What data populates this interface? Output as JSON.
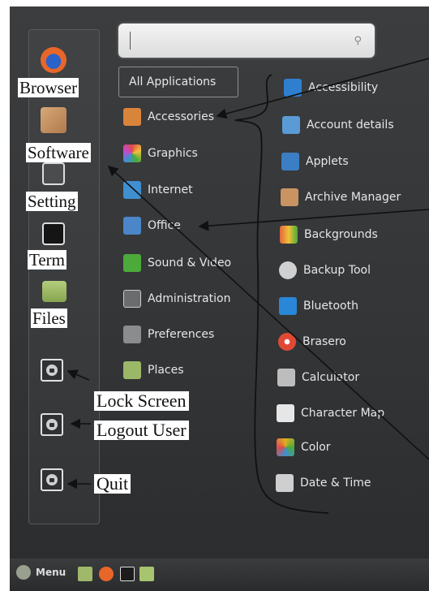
{
  "favorites": [
    {
      "label": "Browser",
      "icon": "firefox-icon",
      "color": "#e8662a"
    },
    {
      "label": "Software",
      "icon": "software-manager-icon",
      "color": "#c79a6a"
    },
    {
      "label": "Setting",
      "icon": "settings-icon",
      "color": "#6b6e70"
    },
    {
      "label": "Term",
      "icon": "terminal-icon",
      "color": "#1c1c1c"
    },
    {
      "label": "Files",
      "icon": "folder-icon",
      "color": "#8fae5a"
    }
  ],
  "system_buttons": [
    {
      "label": "Lock Screen",
      "icon": "lock-icon"
    },
    {
      "label": "Logout User",
      "icon": "logout-icon"
    },
    {
      "label": "Quit",
      "icon": "power-icon"
    }
  ],
  "search": {
    "placeholder": ""
  },
  "all_applications": "All Applications",
  "categories": [
    {
      "label": "Accessories",
      "icon": "accessories-icon",
      "color": "#d9843b"
    },
    {
      "label": "Graphics",
      "icon": "graphics-icon",
      "color": "#d84a8a"
    },
    {
      "label": "Internet",
      "icon": "internet-icon",
      "color": "#3f8fd1"
    },
    {
      "label": "Office",
      "icon": "office-icon",
      "color": "#4b86c8"
    },
    {
      "label": "Sound & Video",
      "icon": "sound-video-icon",
      "color": "#4caa3a"
    },
    {
      "label": "Administration",
      "icon": "administration-icon",
      "color": "#6a6c6e"
    },
    {
      "label": "Preferences",
      "icon": "preferences-icon",
      "color": "#8a8c8e"
    },
    {
      "label": "Places",
      "icon": "places-folder-icon",
      "color": "#9bb868"
    }
  ],
  "applications": [
    {
      "label": "Accessibility",
      "icon": "accessibility-icon",
      "color": "#2f7fd0"
    },
    {
      "label": "Account details",
      "icon": "account-details-icon",
      "color": "#5a9bd5"
    },
    {
      "label": "Applets",
      "icon": "applets-icon",
      "color": "#3c7ec4"
    },
    {
      "label": "Archive Manager",
      "icon": "archive-manager-icon",
      "color": "#c99462"
    },
    {
      "label": "Backgrounds",
      "icon": "backgrounds-icon",
      "color": "#e0663c"
    },
    {
      "label": "Backup Tool",
      "icon": "backup-tool-icon",
      "color": "#d0d0d0"
    },
    {
      "label": "Bluetooth",
      "icon": "bluetooth-icon",
      "color": "#2a86d6"
    },
    {
      "label": "Brasero",
      "icon": "brasero-icon",
      "color": "#e04a35"
    },
    {
      "label": "Calculator",
      "icon": "calculator-icon",
      "color": "#bdbdbd"
    },
    {
      "label": "Character Map",
      "icon": "character-map-icon",
      "color": "#e6e6e6"
    },
    {
      "label": "Color",
      "icon": "color-icon",
      "color": "#e0b020"
    },
    {
      "label": "Date & Time",
      "icon": "date-time-icon",
      "color": "#cfcfcf"
    }
  ],
  "taskbar": {
    "menu_label": "Menu",
    "launchers": [
      {
        "icon": "desktop-icon",
        "color": "#9fb86a"
      },
      {
        "icon": "firefox-icon",
        "color": "#e8662a"
      },
      {
        "icon": "terminal-icon",
        "color": "#1c1c1c"
      },
      {
        "icon": "folder-icon",
        "color": "#a7c46e"
      }
    ]
  }
}
